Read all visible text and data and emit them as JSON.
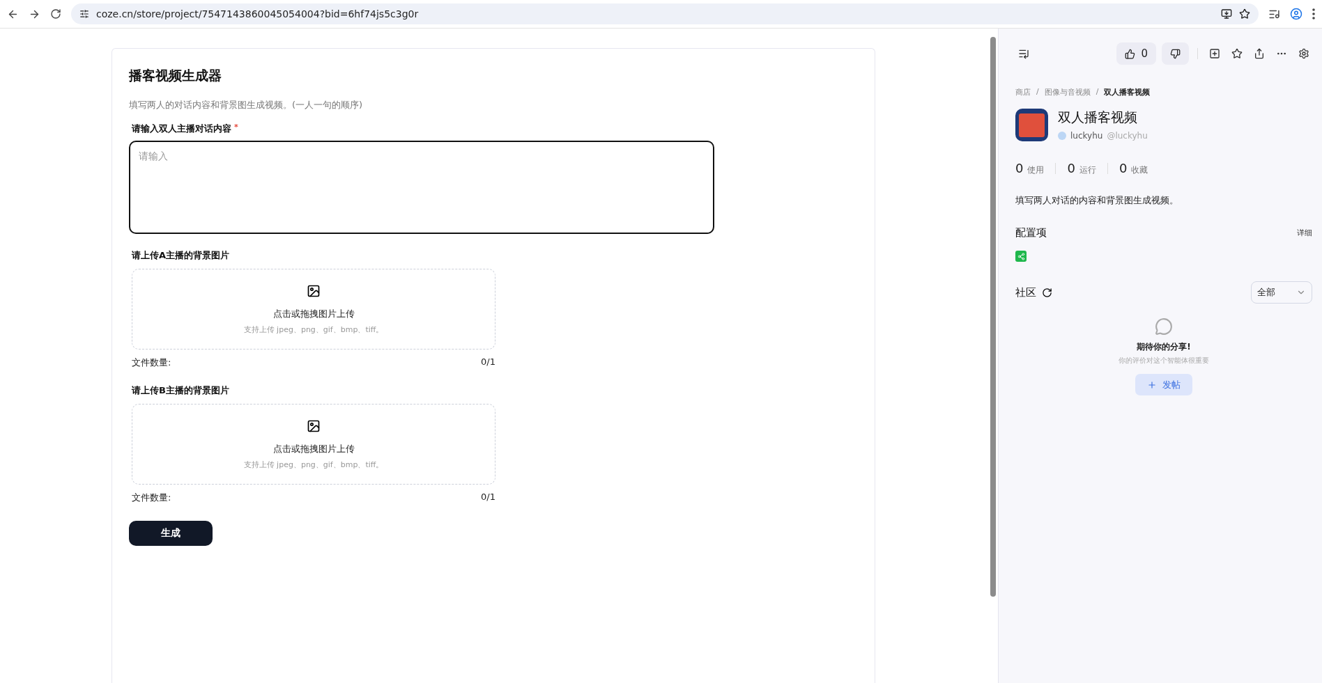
{
  "browser": {
    "url": "coze.cn/store/project/7547143860045054004?bid=6hf74js5c3g0r"
  },
  "form": {
    "title": "播客视频生成器",
    "description": "填写两人的对话内容和背景图生成视频。(一人一句的顺序)",
    "text_field": {
      "label": "请输入双人主播对话内容",
      "required_mark": "*",
      "placeholder": "请输入",
      "focused": true
    },
    "uploads": [
      {
        "label": "请上传A主播的背景图片",
        "prompt": "点击或拖拽图片上传",
        "hint": "支持上传 jpeg、png、gif、bmp、tiff。",
        "count_label": "文件数量:",
        "count": "0/1"
      },
      {
        "label": "请上传B主播的背景图片",
        "prompt": "点击或拖拽图片上传",
        "hint": "支持上传 jpeg、png、gif、bmp、tiff。",
        "count_label": "文件数量:",
        "count": "0/1"
      }
    ],
    "submit": "生成"
  },
  "panel": {
    "likes": "0",
    "breadcrumb": [
      {
        "label": "商店",
        "current": false
      },
      {
        "separator": "/",
        "label": "图像与音视频",
        "current": false
      },
      {
        "separator": "/",
        "label": "双人播客视频",
        "current": true
      }
    ],
    "name": "双人播客视频",
    "author": "luckyhu",
    "handle": "@luckyhu",
    "stats": [
      {
        "value": "0",
        "label": "使用"
      },
      {
        "value": "0",
        "label": "运行"
      },
      {
        "value": "0",
        "label": "收藏"
      }
    ],
    "description": "填写两人对话的内容和背景图生成视频。",
    "config": {
      "title": "配置项",
      "detail": "详细"
    },
    "community": {
      "title": "社区",
      "filter": "全部",
      "empty_title": "期待你的分享!",
      "empty_text": "你的评价对这个智能体很重要",
      "post_button": "发帖"
    }
  }
}
